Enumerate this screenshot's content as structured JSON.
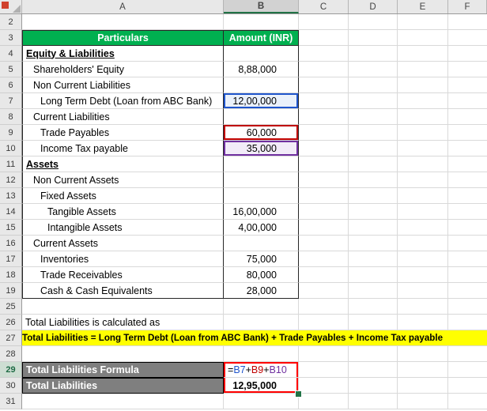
{
  "column_headers": [
    "A",
    "B",
    "C",
    "D",
    "E",
    "F"
  ],
  "selected_column": "B",
  "rows": [
    {
      "num": "2",
      "a": "",
      "b": ""
    },
    {
      "num": "3",
      "a": "Particulars",
      "b": "Amount (INR)"
    },
    {
      "num": "4",
      "a": "Equity & Liabilities",
      "b": ""
    },
    {
      "num": "5",
      "a": "Shareholders' Equity",
      "b": "8,88,000"
    },
    {
      "num": "6",
      "a": "Non Current Liabilities",
      "b": ""
    },
    {
      "num": "7",
      "a": "Long Term Debt (Loan from ABC Bank)",
      "b": "12,00,000"
    },
    {
      "num": "8",
      "a": "Current Liabilities",
      "b": ""
    },
    {
      "num": "9",
      "a": "Trade Payables",
      "b": "60,000"
    },
    {
      "num": "10",
      "a": "Income Tax payable",
      "b": "35,000"
    },
    {
      "num": "11",
      "a": "Assets",
      "b": ""
    },
    {
      "num": "12",
      "a": "Non Current Assets",
      "b": ""
    },
    {
      "num": "13",
      "a": "Fixed Assets",
      "b": ""
    },
    {
      "num": "14",
      "a": "Tangible Assets",
      "b": "16,00,000"
    },
    {
      "num": "15",
      "a": "Intangible Assets",
      "b": "4,00,000"
    },
    {
      "num": "16",
      "a": "Current Assets",
      "b": ""
    },
    {
      "num": "17",
      "a": "Inventories",
      "b": "75,000"
    },
    {
      "num": "18",
      "a": "Trade Receivables",
      "b": "80,000"
    },
    {
      "num": "19",
      "a": "Cash & Cash Equivalents",
      "b": "28,000"
    },
    {
      "num": "25",
      "a": "",
      "b": ""
    },
    {
      "num": "26",
      "a": "Total Liabilities is calculated as",
      "b": ""
    },
    {
      "num": "27",
      "a": "Total Liabilities = Long Term Debt (Loan from ABC Bank) + Trade Payables + Income Tax payable",
      "b": ""
    },
    {
      "num": "28",
      "a": "",
      "b": ""
    },
    {
      "num": "29",
      "a": "Total Liabilities Formula",
      "b": ""
    },
    {
      "num": "30",
      "a": "Total Liabilities",
      "b": "12,95,000"
    },
    {
      "num": "31",
      "a": "",
      "b": ""
    }
  ],
  "formula": {
    "equals": "=",
    "ref1": "B7",
    "plus1": "+",
    "ref2": "B9",
    "plus2": "+",
    "ref3": "B10"
  },
  "colors": {
    "table_header_fill": "#00B050",
    "highlight_fill": "#FFFF00",
    "label_fill": "#7F7F7F",
    "ref_blue": "#1F55CC",
    "ref_red": "#C00000",
    "ref_purple": "#7030A0",
    "annotation_red": "#FF0000",
    "selection_green": "#217346"
  }
}
